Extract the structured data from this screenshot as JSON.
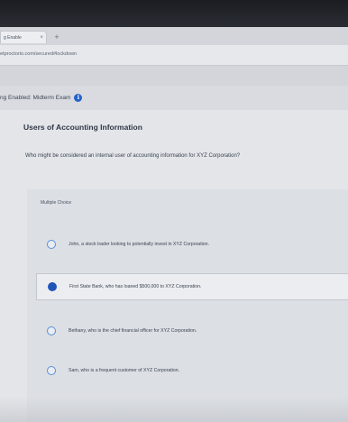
{
  "browser": {
    "tab_label": "g Enable",
    "tab_close": "×",
    "new_tab": "+",
    "url": "etproctorio.com/secured#lockdown"
  },
  "header": {
    "exam_title": "ng Enabled: Midterm Exam",
    "info_icon": "i"
  },
  "main": {
    "section_title": "Users of Accounting Information",
    "question": "Who might be considered an internal user of accounting information for XYZ Corporation?",
    "question_type": "Multiple Choice",
    "options": [
      {
        "label": "John, a stock trader looking to potentially invest in XYZ Corporation.",
        "selected": false
      },
      {
        "label": "First State Bank, who has loaned $500,000 to XYZ Corporation.",
        "selected": true
      },
      {
        "label": "Bethany, who is the chief financial officer for XYZ Corporation.",
        "selected": false
      },
      {
        "label": "Sam, who is a frequent customer of XYZ Corporation.",
        "selected": false
      }
    ]
  },
  "colors": {
    "accent": "#1f55b8",
    "info_icon": "#2563c9"
  }
}
